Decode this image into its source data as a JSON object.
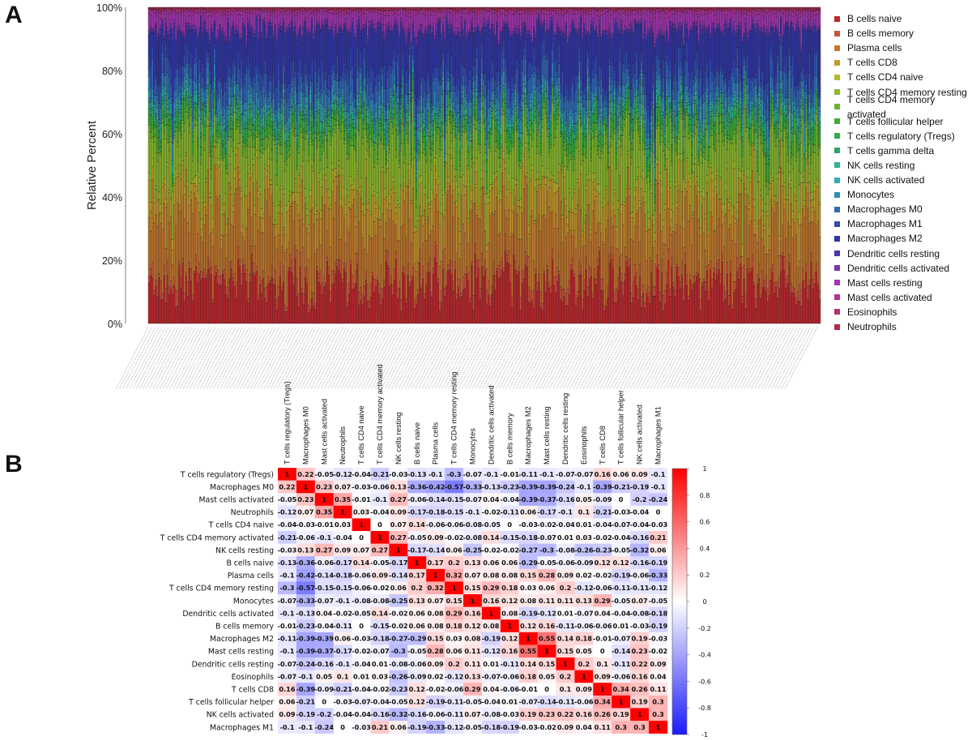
{
  "panels": {
    "a_label": "A",
    "b_label": "B"
  },
  "chart_data": [
    {
      "type": "bar",
      "stacked": true,
      "title": "",
      "xlabel": "",
      "ylabel": "Relative Percent",
      "ylim": [
        0,
        100
      ],
      "yticks": [
        "0%",
        "20%",
        "40%",
        "60%",
        "80%",
        "100%"
      ],
      "sample_count_estimate": 400,
      "x_tick_labels_legible": false,
      "legend_position": "right",
      "series": [
        {
          "name": "B cells naive",
          "color": "#c0272d",
          "approx_mean_percent": 12
        },
        {
          "name": "B cells memory",
          "color": "#c8553a",
          "approx_mean_percent": 3
        },
        {
          "name": "Plasma cells",
          "color": "#c3782d",
          "approx_mean_percent": 18
        },
        {
          "name": "T cells CD8",
          "color": "#c49a2c",
          "approx_mean_percent": 8
        },
        {
          "name": "T cells CD4 naive",
          "color": "#b3b82c",
          "approx_mean_percent": 2
        },
        {
          "name": "T cells CD4 memory resting",
          "color": "#8dbb2d",
          "approx_mean_percent": 14
        },
        {
          "name": "T cells CD4 memory activated",
          "color": "#6db22f",
          "approx_mean_percent": 2
        },
        {
          "name": "T cells follicular helper",
          "color": "#3fae35",
          "approx_mean_percent": 3
        },
        {
          "name": "T cells regulatory (Tregs)",
          "color": "#2fae4e",
          "approx_mean_percent": 2
        },
        {
          "name": "T cells gamma delta",
          "color": "#2fa36a",
          "approx_mean_percent": 1
        },
        {
          "name": "NK cells resting",
          "color": "#2fb391",
          "approx_mean_percent": 2
        },
        {
          "name": "NK cells activated",
          "color": "#30aab4",
          "approx_mean_percent": 1
        },
        {
          "name": "Monocytes",
          "color": "#2f8fb8",
          "approx_mean_percent": 3
        },
        {
          "name": "Macrophages M0",
          "color": "#2f6ab8",
          "approx_mean_percent": 5
        },
        {
          "name": "Macrophages M1",
          "color": "#2f4cb5",
          "approx_mean_percent": 4
        },
        {
          "name": "Macrophages M2",
          "color": "#3035a8",
          "approx_mean_percent": 12
        },
        {
          "name": "Dendritic cells resting",
          "color": "#4c34b0",
          "approx_mean_percent": 1
        },
        {
          "name": "Dendritic cells activated",
          "color": "#7a35b5",
          "approx_mean_percent": 1
        },
        {
          "name": "Mast cells resting",
          "color": "#a534b3",
          "approx_mean_percent": 4
        },
        {
          "name": "Mast cells activated",
          "color": "#b5319a",
          "approx_mean_percent": 1
        },
        {
          "name": "Eosinophils",
          "color": "#b52f6e",
          "approx_mean_percent": 0.5
        },
        {
          "name": "Neutrophils",
          "color": "#b52b48",
          "approx_mean_percent": 0.5
        }
      ]
    },
    {
      "type": "heatmap",
      "title": "",
      "colorbar": {
        "min": -1,
        "max": 1,
        "ticks": [
          "1",
          "0.8",
          "0.6",
          "0.4",
          "0.2",
          "0",
          "-0.2",
          "-0.4",
          "-0.6",
          "-0.8",
          "-1"
        ],
        "low_color": "#1a1aff",
        "mid_color": "#ffffff",
        "high_color": "#ff0000"
      },
      "labels": [
        "T cells regulatory (Tregs)",
        "Macrophages M0",
        "Mast cells activated",
        "Neutrophils",
        "T cells CD4 naive",
        "T cells CD4 memory activated",
        "NK cells resting",
        "B cells naive",
        "Plasma cells",
        "T cells CD4 memory resting",
        "Monocytes",
        "Dendritic cells activated",
        "B cells memory",
        "Macrophages M2",
        "Mast cells resting",
        "Dendritic cells resting",
        "Eosinophils",
        "T cells CD8",
        "T cells follicular helper",
        "NK cells activated",
        "Macrophages M1"
      ],
      "values": [
        [
          1,
          0.22,
          -0.05,
          -0.12,
          -0.04,
          -0.21,
          -0.03,
          -0.13,
          -0.1,
          -0.3,
          -0.07,
          -0.1,
          -0.01,
          -0.11,
          -0.1,
          -0.07,
          -0.07,
          0.16,
          0.06,
          0.09,
          -0.1
        ],
        [
          0.22,
          1,
          0.23,
          0.07,
          -0.03,
          -0.06,
          0.13,
          -0.36,
          -0.42,
          -0.57,
          -0.33,
          -0.13,
          -0.23,
          -0.39,
          -0.39,
          -0.24,
          -0.1,
          -0.39,
          -0.21,
          -0.19,
          -0.1
        ],
        [
          -0.05,
          0.23,
          1,
          0.35,
          -0.01,
          -0.1,
          0.27,
          -0.06,
          -0.14,
          -0.15,
          -0.07,
          0.04,
          -0.04,
          -0.39,
          -0.37,
          -0.16,
          0.05,
          -0.09,
          0,
          -0.2,
          -0.24
        ],
        [
          -0.12,
          0.07,
          0.35,
          1,
          0.03,
          -0.04,
          0.09,
          -0.17,
          -0.18,
          -0.15,
          -0.1,
          -0.02,
          -0.11,
          0.06,
          -0.17,
          -0.1,
          0.1,
          -0.21,
          -0.03,
          -0.04,
          0
        ],
        [
          -0.04,
          -0.03,
          -0.01,
          0.03,
          1,
          0,
          0.07,
          0.14,
          -0.06,
          -0.06,
          -0.08,
          -0.05,
          0,
          -0.03,
          -0.02,
          -0.04,
          0.01,
          -0.04,
          -0.07,
          -0.04,
          -0.03
        ],
        [
          -0.21,
          -0.06,
          -0.1,
          -0.04,
          0,
          1,
          0.27,
          -0.05,
          0.09,
          -0.02,
          -0.08,
          0.14,
          -0.15,
          -0.18,
          -0.07,
          0.01,
          0.03,
          -0.02,
          -0.04,
          -0.16,
          0.21
        ],
        [
          -0.03,
          0.13,
          0.27,
          0.09,
          0.07,
          0.27,
          1,
          -0.17,
          -0.14,
          0.06,
          -0.25,
          -0.02,
          -0.02,
          -0.27,
          -0.3,
          -0.08,
          -0.26,
          -0.23,
          -0.05,
          -0.32,
          0.06
        ],
        [
          -0.13,
          -0.36,
          -0.06,
          -0.17,
          0.14,
          -0.05,
          -0.17,
          1,
          0.17,
          0.2,
          0.13,
          0.06,
          0.06,
          -0.29,
          -0.05,
          -0.06,
          -0.09,
          0.12,
          0.12,
          -0.16,
          -0.19
        ],
        [
          -0.1,
          -0.42,
          -0.14,
          -0.18,
          -0.06,
          0.09,
          -0.14,
          0.17,
          1,
          0.32,
          0.07,
          0.08,
          0.08,
          0.15,
          0.28,
          0.09,
          0.02,
          -0.02,
          -0.19,
          -0.06,
          -0.33
        ],
        [
          -0.3,
          -0.57,
          -0.15,
          -0.15,
          -0.06,
          -0.02,
          0.06,
          0.2,
          0.32,
          1,
          0.15,
          0.29,
          0.18,
          0.03,
          0.06,
          0.2,
          -0.12,
          -0.06,
          -0.11,
          -0.11,
          -0.12
        ],
        [
          -0.07,
          -0.33,
          -0.07,
          -0.1,
          -0.08,
          -0.08,
          -0.25,
          0.13,
          0.07,
          0.15,
          1,
          0.16,
          0.12,
          0.08,
          0.11,
          0.11,
          0.13,
          0.29,
          -0.05,
          0.07,
          -0.05
        ],
        [
          -0.1,
          -0.13,
          0.04,
          -0.02,
          -0.05,
          0.14,
          -0.02,
          0.06,
          0.08,
          0.29,
          0.16,
          1,
          0.08,
          -0.19,
          -0.12,
          0.01,
          -0.07,
          0.04,
          -0.04,
          -0.08,
          -0.18
        ],
        [
          -0.01,
          -0.23,
          -0.04,
          -0.11,
          0,
          -0.15,
          -0.02,
          0.06,
          0.08,
          0.18,
          0.12,
          0.08,
          1,
          0.12,
          0.16,
          -0.11,
          -0.06,
          -0.06,
          0.01,
          -0.03,
          -0.19
        ],
        [
          -0.11,
          -0.39,
          -0.39,
          0.06,
          -0.03,
          -0.18,
          -0.27,
          -0.29,
          0.15,
          0.03,
          0.08,
          -0.19,
          0.12,
          1,
          0.55,
          0.14,
          0.18,
          -0.01,
          -0.07,
          0.19,
          -0.03
        ],
        [
          -0.1,
          -0.39,
          -0.37,
          -0.17,
          -0.02,
          -0.07,
          -0.3,
          -0.05,
          0.28,
          0.06,
          0.11,
          -0.12,
          0.16,
          0.55,
          1,
          0.15,
          0.05,
          0,
          -0.14,
          0.23,
          -0.02
        ],
        [
          -0.07,
          -0.24,
          -0.16,
          -0.1,
          -0.04,
          0.01,
          -0.08,
          -0.06,
          0.09,
          0.2,
          0.11,
          0.01,
          -0.11,
          0.14,
          0.15,
          1,
          0.2,
          0.1,
          -0.11,
          0.22,
          0.09
        ],
        [
          -0.07,
          -0.1,
          0.05,
          0.1,
          0.01,
          0.03,
          -0.26,
          -0.09,
          0.02,
          -0.12,
          0.13,
          -0.07,
          -0.06,
          0.18,
          0.05,
          0.2,
          1,
          0.09,
          -0.06,
          0.16,
          0.04
        ],
        [
          0.16,
          -0.39,
          -0.09,
          -0.21,
          -0.04,
          -0.02,
          -0.23,
          0.12,
          -0.02,
          -0.06,
          0.29,
          0.04,
          -0.06,
          -0.01,
          0,
          0.1,
          0.09,
          1,
          0.34,
          0.26,
          0.11
        ],
        [
          0.06,
          -0.21,
          0,
          -0.03,
          -0.07,
          -0.04,
          -0.05,
          0.12,
          -0.19,
          -0.11,
          -0.05,
          -0.04,
          0.01,
          -0.07,
          -0.14,
          -0.11,
          -0.06,
          0.34,
          1,
          0.19,
          0.3
        ],
        [
          0.09,
          -0.19,
          -0.2,
          -0.04,
          -0.04,
          -0.16,
          -0.32,
          -0.16,
          -0.06,
          -0.11,
          0.07,
          -0.08,
          -0.03,
          0.19,
          0.23,
          0.22,
          0.16,
          0.26,
          0.19,
          1,
          0.3
        ],
        [
          -0.1,
          -0.1,
          -0.24,
          0,
          -0.03,
          0.21,
          0.06,
          -0.19,
          -0.33,
          -0.12,
          -0.05,
          -0.18,
          -0.19,
          -0.03,
          -0.02,
          0.09,
          0.04,
          0.11,
          0.3,
          0.3,
          1
        ]
      ]
    }
  ]
}
